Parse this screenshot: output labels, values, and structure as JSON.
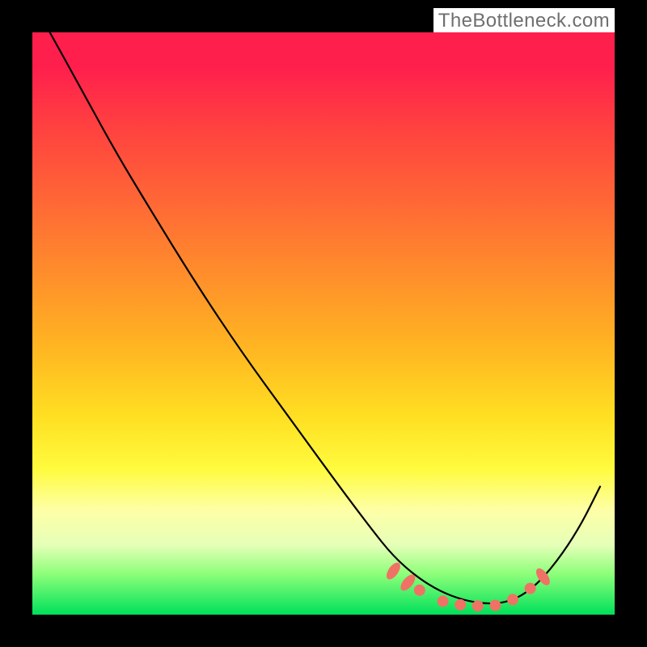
{
  "attribution": "TheBottleneck.com",
  "colors": {
    "gradient_top": "#ff1f4d",
    "gradient_mid": "#ffdf22",
    "gradient_bottom": "#00e05a",
    "curve": "#000000",
    "marker": "#f07265",
    "frame": "#000000"
  },
  "chart_data": {
    "type": "line",
    "title": "",
    "xlabel": "",
    "ylabel": "",
    "xlim": [
      0,
      1
    ],
    "ylim": [
      0,
      1
    ],
    "notes": "Bottleneck-style curve. No axes/ticks drawn. x and y are normalized fractions of the plot area (x left→right, y top→bottom). Valley ≈0 bottleneck (green); peak ≈1 (red).",
    "x": [
      0.03,
      0.08,
      0.14,
      0.2,
      0.28,
      0.36,
      0.44,
      0.52,
      0.58,
      0.62,
      0.66,
      0.7,
      0.74,
      0.78,
      0.82,
      0.86,
      0.9,
      0.94,
      0.975
    ],
    "y": [
      0.0,
      0.09,
      0.2,
      0.3,
      0.43,
      0.55,
      0.66,
      0.77,
      0.85,
      0.9,
      0.935,
      0.96,
      0.975,
      0.982,
      0.978,
      0.955,
      0.91,
      0.85,
      0.78
    ],
    "markers": {
      "circles_x": [
        0.665,
        0.705,
        0.735,
        0.765,
        0.795,
        0.825,
        0.855
      ],
      "circles_y": [
        0.958,
        0.977,
        0.983,
        0.985,
        0.984,
        0.974,
        0.955
      ],
      "ovals": [
        {
          "x": 0.62,
          "y": 0.925,
          "angle": -55
        },
        {
          "x": 0.645,
          "y": 0.945,
          "angle": -50
        },
        {
          "x": 0.877,
          "y": 0.935,
          "angle": 55
        }
      ]
    }
  }
}
